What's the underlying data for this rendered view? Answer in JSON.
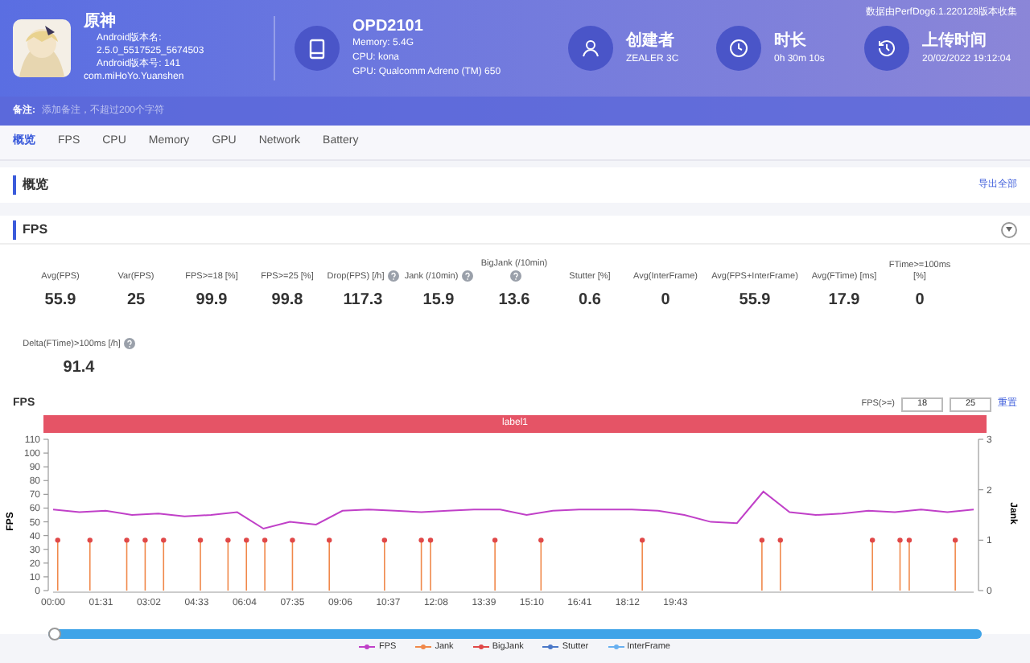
{
  "header": {
    "source_note": "数据由PerfDog6.1.220128版本收集",
    "app": {
      "name": "原神",
      "lines": [
        "Android版本名:",
        "2.5.0_5517525_5674503",
        "Android版本号: 141"
      ],
      "package": "com.miHoYo.Yuanshen"
    },
    "device": {
      "name": "OPD2101",
      "lines": [
        "Memory: 5.4G",
        "CPU: kona",
        "GPU: Qualcomm Adreno (TM) 650"
      ]
    },
    "infos": [
      {
        "kind": "user",
        "title": "创建者",
        "value": "ZEALER 3C"
      },
      {
        "kind": "clock",
        "title": "时长",
        "value": "0h 30m 10s"
      },
      {
        "kind": "history",
        "title": "上传时间",
        "value": "20/02/2022 19:12:04"
      }
    ],
    "note": {
      "label": "备注:",
      "placeholder": "添加备注，不超过200个字符"
    }
  },
  "tabs": [
    {
      "label": "概览",
      "selected": true
    },
    {
      "label": "FPS",
      "selected": false
    },
    {
      "label": "CPU",
      "selected": false
    },
    {
      "label": "Memory",
      "selected": false
    },
    {
      "label": "GPU",
      "selected": false
    },
    {
      "label": "Network",
      "selected": false
    },
    {
      "label": "Battery",
      "selected": false
    }
  ],
  "overview": {
    "title": "概览",
    "export": "导出全部"
  },
  "fps_section": {
    "title": "FPS",
    "expanded": true,
    "stats": [
      {
        "label": "Avg(FPS)",
        "value": "55.9",
        "help": false
      },
      {
        "label": "Var(FPS)",
        "value": "25",
        "help": false
      },
      {
        "label": "FPS>=18 [%]",
        "value": "99.9",
        "help": false
      },
      {
        "label": "FPS>=25 [%]",
        "value": "99.8",
        "help": false
      },
      {
        "label": "Drop(FPS) [/h]",
        "value": "117.3",
        "help": true
      },
      {
        "label": "Jank (/10min)",
        "value": "15.9",
        "help": true
      },
      {
        "label": "BigJank (/10min)",
        "value": "13.6",
        "help": true
      },
      {
        "label": "Stutter [%]",
        "value": "0.6",
        "help": false
      },
      {
        "label": "Avg(InterFrame)",
        "value": "0",
        "help": false
      },
      {
        "label": "Avg(FPS+InterFrame)",
        "value": "55.9",
        "help": false
      },
      {
        "label": "Avg(FTime) [ms]",
        "value": "17.9",
        "help": false
      },
      {
        "label": "FTime>=100ms [%]",
        "value": "0",
        "help": false
      },
      {
        "label": "Delta(FTime)>100ms [/h]",
        "value": "91.4",
        "help": true
      }
    ],
    "chart": {
      "title": "FPS",
      "threshold_label": "FPS(>=)",
      "thresholds": [
        "18",
        "25"
      ],
      "reset": "重置",
      "band_label": "label1",
      "chart_data": {
        "type": "line",
        "ylabel": "FPS",
        "y2label": "Jank",
        "x": [
          0,
          50,
          100,
          150,
          200,
          250,
          300,
          350,
          400,
          450,
          500,
          550,
          600,
          650,
          700,
          750,
          800,
          850,
          900,
          950,
          1000,
          1050,
          1100,
          1150,
          1200,
          1250,
          1300,
          1350,
          1400,
          1450,
          1500,
          1550,
          1600,
          1650,
          1700,
          1750
        ],
        "xlim": [
          0,
          1750
        ],
        "ylim": [
          0,
          110
        ],
        "y2lim": [
          0,
          3
        ],
        "xticks": [
          {
            "value": 0,
            "label": "00:00"
          },
          {
            "value": 91,
            "label": "01:31"
          },
          {
            "value": 182,
            "label": "03:02"
          },
          {
            "value": 273,
            "label": "04:33"
          },
          {
            "value": 364,
            "label": "06:04"
          },
          {
            "value": 455,
            "label": "07:35"
          },
          {
            "value": 546,
            "label": "09:06"
          },
          {
            "value": 637,
            "label": "10:37"
          },
          {
            "value": 728,
            "label": "12:08"
          },
          {
            "value": 819,
            "label": "13:39"
          },
          {
            "value": 910,
            "label": "15:10"
          },
          {
            "value": 1001,
            "label": "16:41"
          },
          {
            "value": 1092,
            "label": "18:12"
          },
          {
            "value": 1183,
            "label": "19:43"
          }
        ],
        "yticks": [
          0,
          10,
          20,
          30,
          40,
          50,
          60,
          70,
          80,
          90,
          100,
          110
        ],
        "y2ticks": [
          0,
          1,
          2,
          3
        ],
        "series": [
          {
            "name": "FPS",
            "color": "#c040c8",
            "values": [
              59,
              57,
              58,
              55,
              56,
              54,
              55,
              57,
              45,
              50,
              48,
              58,
              59,
              58,
              57,
              58,
              59,
              59,
              55,
              58,
              59,
              59,
              59,
              58,
              55,
              50,
              49,
              72,
              57,
              55,
              56,
              58,
              57,
              59,
              57,
              59
            ]
          }
        ]
      },
      "legend_extra": [
        {
          "name": "Jank",
          "color": "#f0884a"
        },
        {
          "name": "BigJank",
          "color": "#e04848"
        },
        {
          "name": "Stutter",
          "color": "#4a78c8"
        },
        {
          "name": "InterFrame",
          "color": "#68b0f0"
        }
      ],
      "range_slider": {
        "level": 1
      }
    }
  }
}
